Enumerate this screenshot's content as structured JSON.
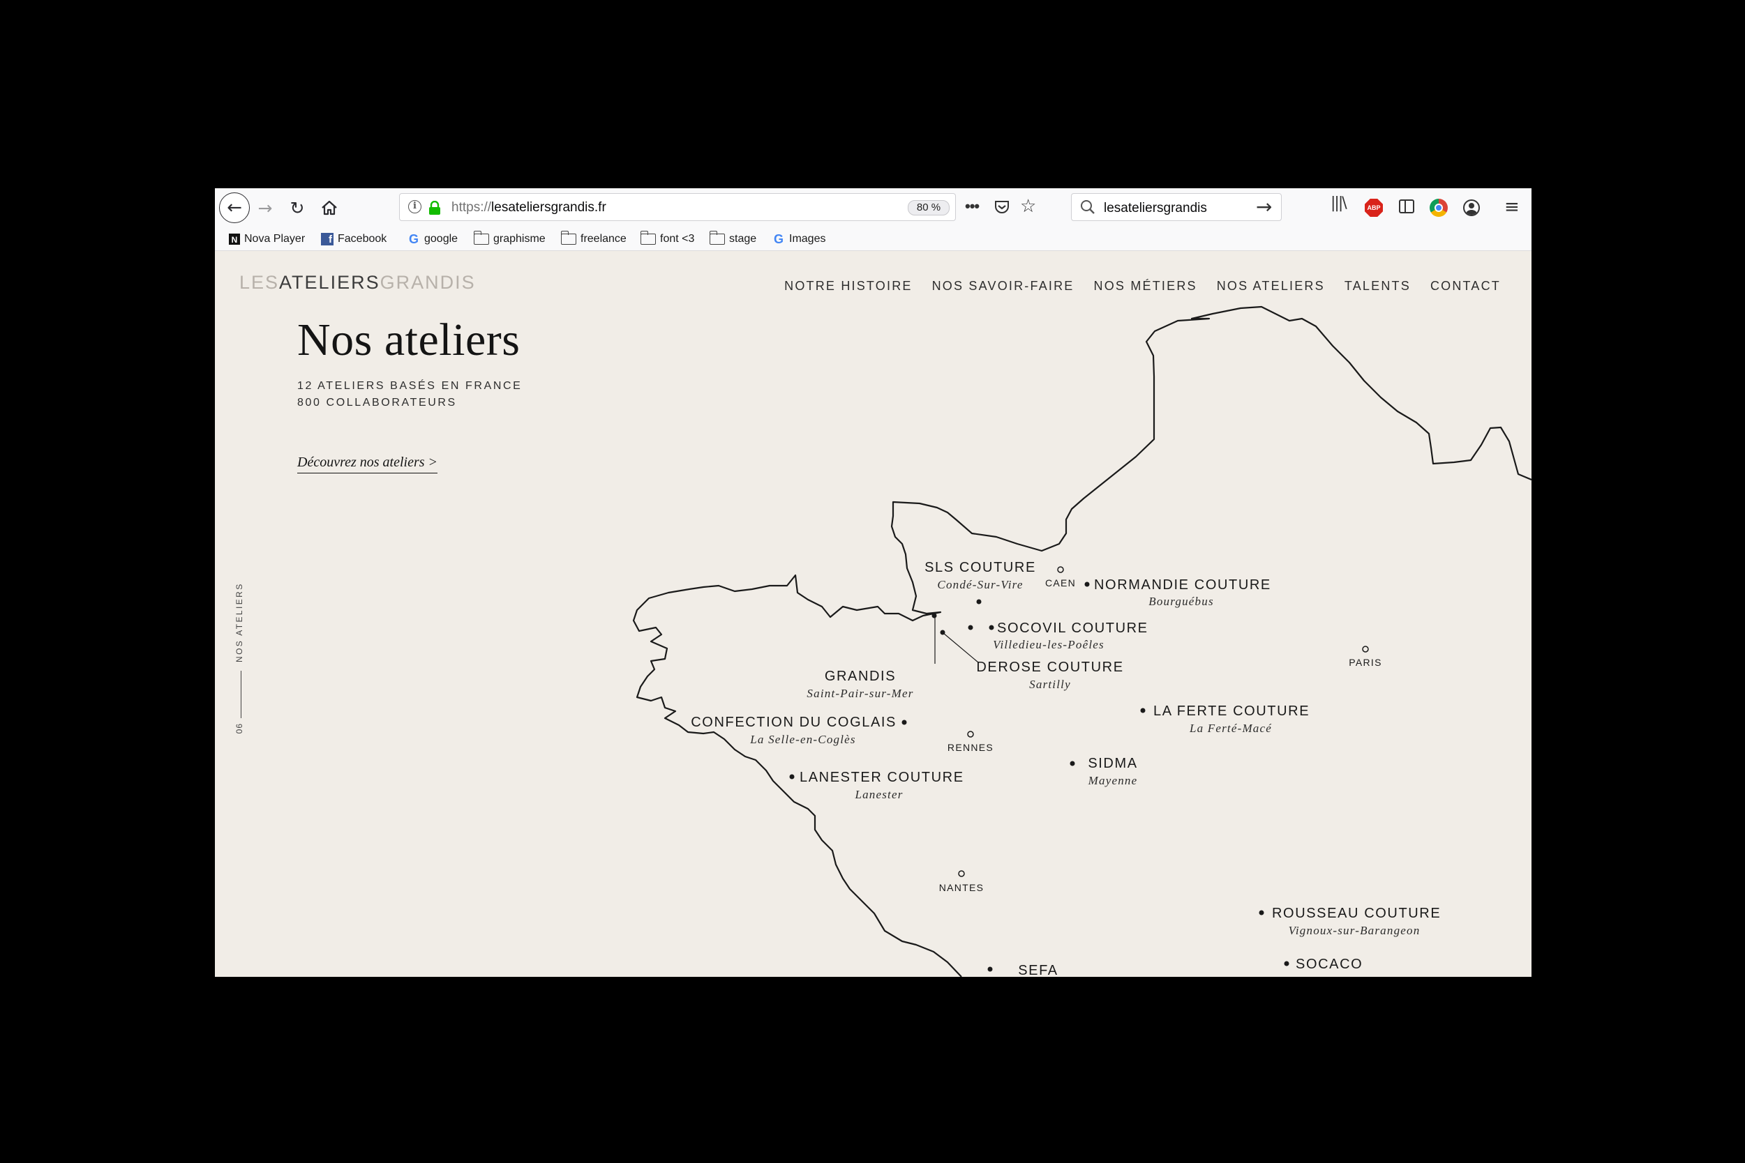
{
  "browser": {
    "url_protocol": "https://",
    "url_domain": "lesateliersgrandis.fr",
    "zoom": "80 %",
    "search_text": "lesateliersgrandis",
    "bookmarks": [
      {
        "label": "Nova Player",
        "icon": "nova-icon"
      },
      {
        "label": "Facebook",
        "icon": "facebook-icon"
      },
      {
        "label": "google",
        "icon": "google-icon"
      },
      {
        "label": "graphisme",
        "icon": "folder-icon"
      },
      {
        "label": "freelance",
        "icon": "folder-icon"
      },
      {
        "label": "font <3",
        "icon": "folder-icon"
      },
      {
        "label": "stage",
        "icon": "folder-icon"
      },
      {
        "label": "Images",
        "icon": "google-icon"
      }
    ],
    "abp_label": "ABP"
  },
  "site": {
    "logo_part1": "LES",
    "logo_part2": "ATELIERS",
    "logo_part3": "GRANDIS",
    "nav": [
      "NOTRE HISTOIRE",
      "NOS SAVOIR-FAIRE",
      "NOS MÉTIERS",
      "NOS ATELIERS",
      "TALENTS",
      "CONTACT"
    ],
    "title": "Nos ateliers",
    "subtitle_line1": "12 ATELIERS BASÉS EN FRANCE",
    "subtitle_line2": "800 COLLABORATEURS",
    "discover_link": "Découvrez nos ateliers >",
    "side_label": "NOS ATELIERS",
    "side_number": "06"
  },
  "map": {
    "ateliers": [
      {
        "name": "SLS COUTURE",
        "place": "Condé-Sur-Vire"
      },
      {
        "name": "NORMANDIE COUTURE",
        "place": "Bourguébus"
      },
      {
        "name": "SOCOVIL COUTURE",
        "place": "Villedieu-les-Poêles"
      },
      {
        "name": "DEROSE COUTURE",
        "place": "Sartilly"
      },
      {
        "name": "GRANDIS",
        "place": "Saint-Pair-sur-Mer"
      },
      {
        "name": "CONFECTION DU COGLAIS",
        "place": "La Selle-en-Coglès"
      },
      {
        "name": "LA FERTE COUTURE",
        "place": "La Ferté-Macé"
      },
      {
        "name": "SIDMA",
        "place": "Mayenne"
      },
      {
        "name": "LANESTER COUTURE",
        "place": "Lanester"
      },
      {
        "name": "ROUSSEAU COUTURE",
        "place": "Vignoux-sur-Barangeon"
      },
      {
        "name": "SOCACO",
        "place": ""
      },
      {
        "name": "SEFA",
        "place": ""
      }
    ],
    "cities": [
      "CAEN",
      "PARIS",
      "RENNES",
      "NANTES"
    ]
  }
}
